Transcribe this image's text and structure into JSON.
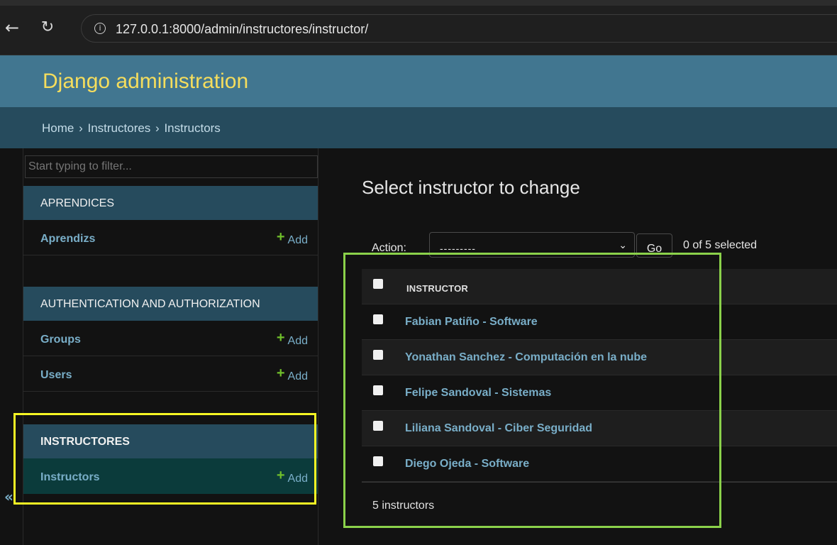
{
  "browser": {
    "url": "127.0.0.1:8000/admin/instructores/instructor/"
  },
  "header": {
    "branding": "Django administration"
  },
  "breadcrumbs": {
    "home": "Home",
    "app": "Instructores",
    "model": "Instructors",
    "separator": "›"
  },
  "sidebar": {
    "filter_placeholder": "Start typing to filter...",
    "apps": [
      {
        "caption": "APRENDICES",
        "models": [
          {
            "label": "Aprendizs",
            "add": "Add"
          }
        ]
      },
      {
        "caption": "AUTHENTICATION AND AUTHORIZATION",
        "models": [
          {
            "label": "Groups",
            "add": "Add"
          },
          {
            "label": "Users",
            "add": "Add"
          }
        ]
      },
      {
        "caption": "INSTRUCTORES",
        "models": [
          {
            "label": "Instructors",
            "add": "Add"
          }
        ]
      }
    ],
    "collapse": "«"
  },
  "main": {
    "title": "Select instructor to change",
    "actions": {
      "label": "Action:",
      "selected_value": "---------",
      "go": "Go",
      "selection_count": "0 of 5 selected"
    },
    "table": {
      "header": "INSTRUCTOR",
      "rows": [
        "Fabian Patiño - Software",
        "Yonathan Sanchez - Computación en la nube",
        "Felipe Sandoval - Sistemas",
        "Liliana Sandoval - Ciber Seguridad",
        "Diego Ojeda - Software"
      ]
    },
    "paginator": "5 instructors"
  },
  "colors": {
    "header_bg": "#417690",
    "branding": "#f5dd5d",
    "breadcrumbs_bg": "#264b5d",
    "link": "#79aec8",
    "add_plus": "#70bf2b",
    "highlight_sidebar": "#f5f524",
    "highlight_table": "#8bd14a"
  }
}
